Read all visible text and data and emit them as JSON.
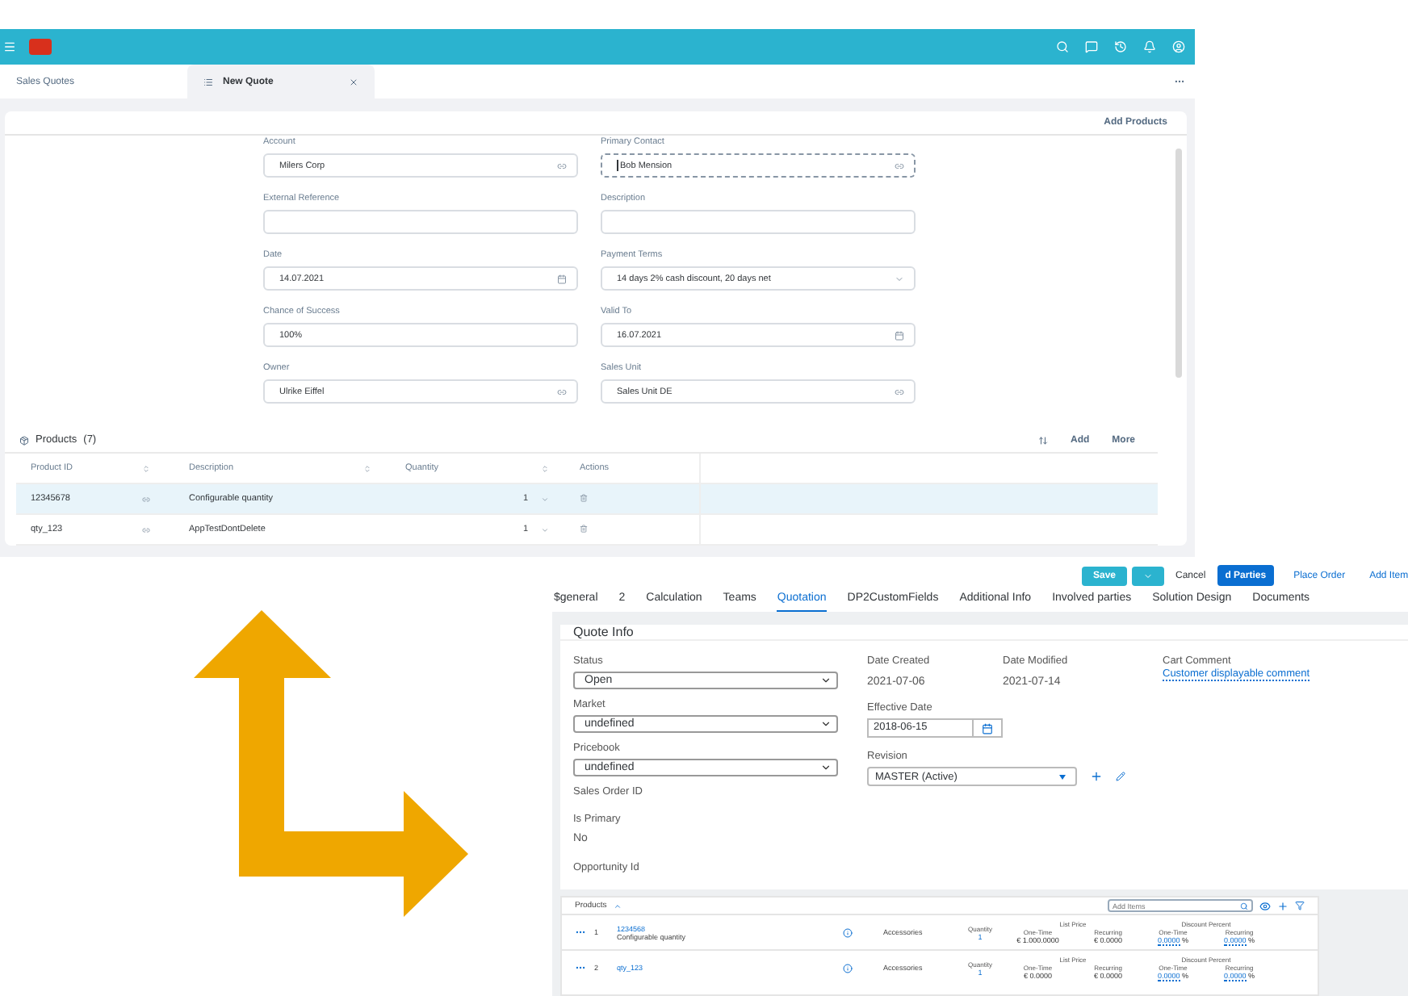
{
  "top_screen": {
    "shell_tabs": [
      {
        "label": "Sales Quotes",
        "selected": false
      },
      {
        "label": "New Quote",
        "selected": true
      }
    ],
    "card_action": "Add Products",
    "left_fields": [
      {
        "label": "Account",
        "value": "Milers Corp",
        "kind": "lookup",
        "focused": false
      },
      {
        "label": "External Reference",
        "kind": "text",
        "focused": false
      },
      {
        "label": "Date",
        "value": "14.07.2021",
        "kind": "date",
        "focused": false
      },
      {
        "label": "Chance of Success",
        "value": "100%",
        "kind": "text",
        "focused": false
      },
      {
        "label": "Owner",
        "value": "Ulrike Eiffel",
        "kind": "lookup",
        "focused": false
      }
    ],
    "right_fields": [
      {
        "label": "Primary Contact",
        "value": "Bob Mension",
        "kind": "lookup",
        "focused": true
      },
      {
        "label": "Description",
        "kind": "text",
        "focused": false
      },
      {
        "label": "Payment Terms",
        "value": "14 days 2% cash discount, 20 days net",
        "kind": "select",
        "focused": false
      },
      {
        "label": "Valid To",
        "value": "16.07.2021",
        "kind": "date",
        "focused": false
      },
      {
        "label": "Sales Unit",
        "value": "Sales Unit DE",
        "kind": "lookup",
        "focused": false
      }
    ],
    "products": {
      "title": "Products",
      "count": "(7)",
      "actions": [
        "Add",
        "More"
      ],
      "columns": [
        "Product ID",
        "Description",
        "Quantity",
        "Actions"
      ],
      "rows": [
        {
          "product_id": "12345678",
          "description": "Configurable quantity",
          "quantity": "1",
          "selected": true
        },
        {
          "product_id": "qty_123",
          "description": "AppTestDontDelete",
          "quantity": "1",
          "selected": false
        }
      ]
    }
  },
  "bottom_screen": {
    "save": "Save",
    "cancel": "Cancel",
    "actions": [
      {
        "label": "d Parties",
        "kind": "primary"
      },
      {
        "label": "Place Order",
        "kind": "link"
      },
      {
        "label": "Add Item",
        "kind": "link"
      }
    ],
    "tabs": [
      {
        "label": "$general",
        "selected": false
      },
      {
        "label": "2",
        "selected": false
      },
      {
        "label": "Calculation",
        "selected": false
      },
      {
        "label": "Teams",
        "selected": false
      },
      {
        "label": "Quotation",
        "selected": true
      },
      {
        "label": "DP2CustomFields",
        "selected": false
      },
      {
        "label": "Additional Info",
        "selected": false
      },
      {
        "label": "Involved parties",
        "selected": false
      },
      {
        "label": "Solution Design",
        "selected": false
      },
      {
        "label": "Documents",
        "selected": false
      }
    ],
    "card_title": "Quote Info",
    "left_fields": [
      {
        "label": "Status",
        "value": "Open",
        "kind": "select"
      },
      {
        "label": "Market",
        "value": "undefined",
        "kind": "select"
      },
      {
        "label": "Pricebook",
        "value": "undefined",
        "kind": "select"
      },
      {
        "label": "Sales Order ID",
        "kind": "plain"
      },
      {
        "label": "Is Primary",
        "value": "No",
        "kind": "plain"
      },
      {
        "label": "Opportunity Id",
        "kind": "plain"
      }
    ],
    "date_created": {
      "label": "Date Created",
      "value": "2021-07-06"
    },
    "date_modified": {
      "label": "Date Modified",
      "value": "2021-07-14"
    },
    "effective_date": {
      "label": "Effective Date",
      "value": "2018-06-15"
    },
    "revision": {
      "label": "Revision",
      "value": "MASTER (Active)"
    },
    "cart_comment": {
      "label": "Cart Comment",
      "link": "Customer displayable comment"
    },
    "products": {
      "title": "Products",
      "search_placeholder": "Add Items",
      "rows": [
        {
          "quantity_label": "Quantity",
          "list_price_label": "List Price",
          "discount_label": "Discount Percent",
          "list_one_time_label": "One-Time",
          "list_recurring_label": "Recurring",
          "discount_one_time_label": "One-Time",
          "discount_recurring_label": "Recurring",
          "index": "1",
          "product_id": "1234568",
          "description": "Configurable quantity",
          "category": "Accessories",
          "quantity": "1",
          "list_one_time": "€ 1.000.0000",
          "list_recurring": "€ 0.0000",
          "discount_one_time": "0.0000",
          "discount_recurring": "0.0000",
          "unit": "%"
        },
        {
          "quantity_label": "Quantity",
          "list_price_label": "List Price",
          "discount_label": "Discount Percent",
          "list_one_time_label": "One-Time",
          "list_recurring_label": "Recurring",
          "discount_one_time_label": "One-Time",
          "discount_recurring_label": "Recurring",
          "index": "2",
          "product_id": "qty_123",
          "category": "Accessories",
          "quantity": "1",
          "list_one_time": "€ 0.0000",
          "list_recurring": "€ 0.0000",
          "discount_one_time": "0.0000",
          "discount_recurring": "0.0000",
          "unit": "%"
        }
      ]
    }
  }
}
